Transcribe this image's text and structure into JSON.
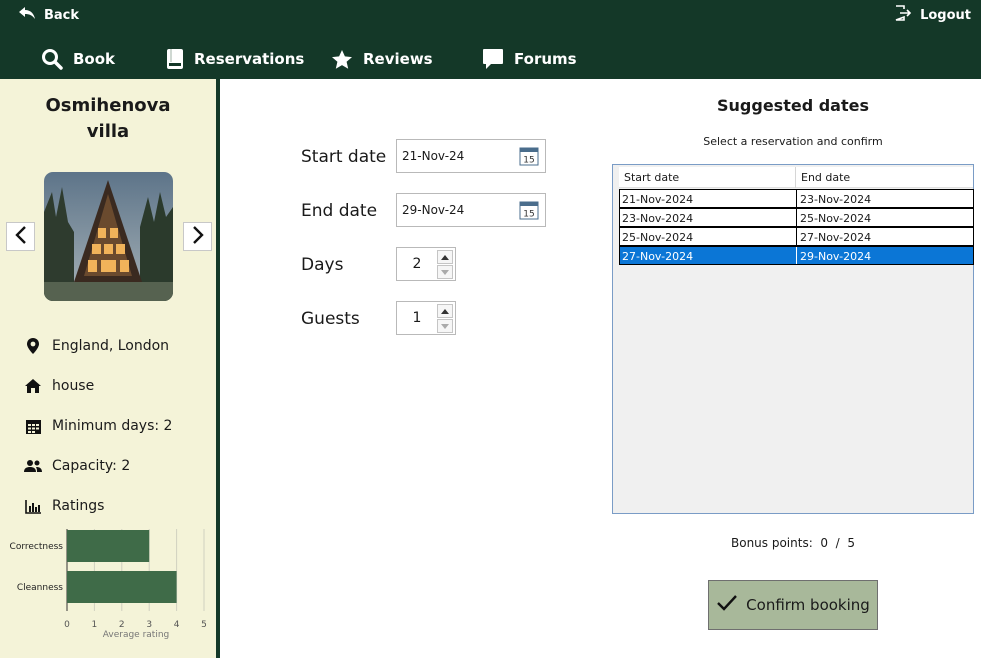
{
  "header": {
    "back_label": "Back",
    "logout_label": "Logout",
    "nav": [
      {
        "label": "Book",
        "icon": "search-icon"
      },
      {
        "label": "Reservations",
        "icon": "book-icon"
      },
      {
        "label": "Reviews",
        "icon": "star-icon"
      },
      {
        "label": "Forums",
        "icon": "chat-icon"
      }
    ]
  },
  "sidebar": {
    "name_line1": "Osmihenova",
    "name_line2": "villa",
    "location": "England, London",
    "type": "house",
    "min_days": "Minimum days: 2",
    "capacity": "Capacity: 2",
    "ratings_label": "Ratings",
    "ratings_chart": {
      "type": "bar",
      "orientation": "horizontal",
      "categories": [
        "Correctness",
        "Cleanness"
      ],
      "values": [
        3,
        4
      ],
      "xlabel": "Average rating",
      "xlim": [
        0,
        5
      ],
      "ticks": [
        "0",
        "1",
        "2",
        "3",
        "4",
        "5"
      ]
    }
  },
  "form": {
    "start_label": "Start date",
    "start_value": "21-Nov-24",
    "end_label": "End date",
    "end_value": "29-Nov-24",
    "days_label": "Days",
    "days_value": "2",
    "guests_label": "Guests",
    "guests_value": "1",
    "calendar_day": "15"
  },
  "suggested": {
    "title": "Suggested dates",
    "subtitle": "Select a reservation and confirm",
    "columns": [
      "Start date",
      "End date"
    ],
    "rows": [
      {
        "start": "21-Nov-2024",
        "end": "23-Nov-2024"
      },
      {
        "start": "23-Nov-2024",
        "end": "25-Nov-2024"
      },
      {
        "start": "25-Nov-2024",
        "end": "27-Nov-2024"
      },
      {
        "start": "27-Nov-2024",
        "end": "29-Nov-2024"
      }
    ],
    "selected_index": 3
  },
  "bonus": {
    "label": "Bonus points:",
    "value": "0",
    "sep": "/",
    "max": "5"
  },
  "confirm_label": "Confirm booking",
  "colors": {
    "header_bg": "#143828",
    "sidebar_bg": "#f4f3d8",
    "bar_fill": "#3f6b48",
    "selection": "#0b76d6",
    "confirm_bg": "#a8b89a"
  }
}
